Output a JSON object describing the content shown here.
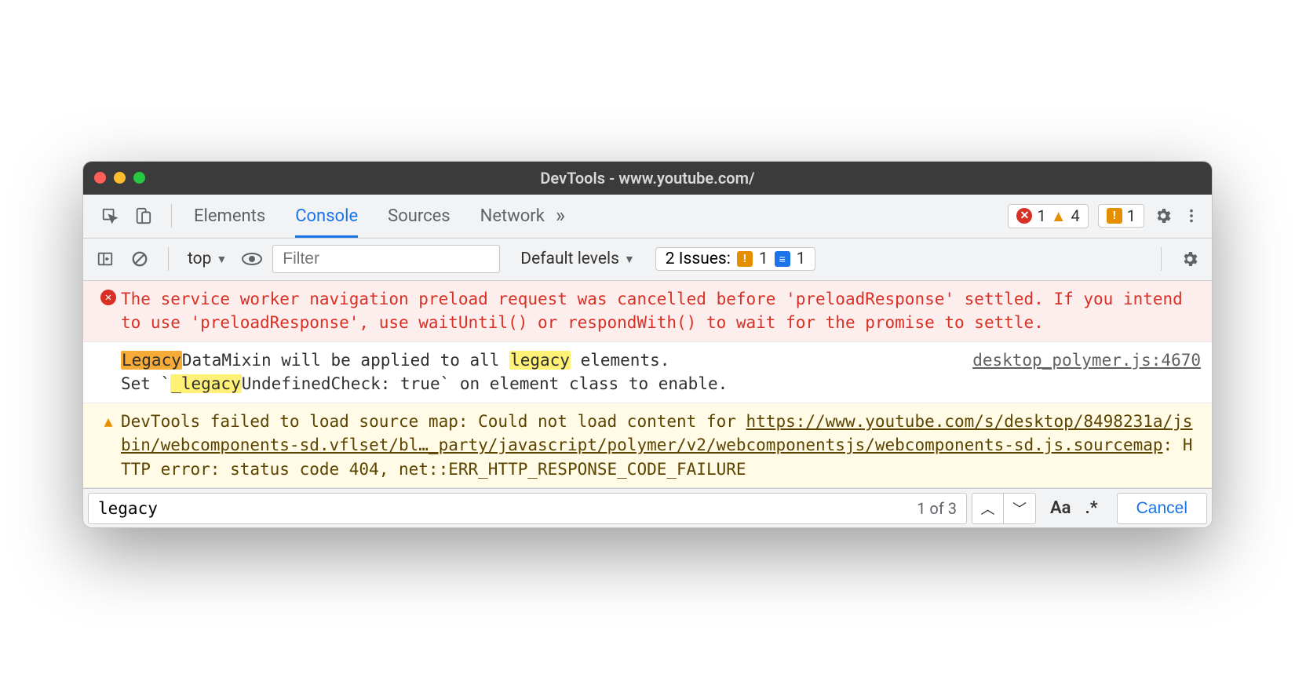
{
  "window": {
    "title": "DevTools - www.youtube.com/"
  },
  "tabs": {
    "items": [
      "Elements",
      "Console",
      "Sources",
      "Network"
    ],
    "active_index": 1
  },
  "badges": {
    "errors": "1",
    "warnings": "4",
    "issues_orange": "1"
  },
  "subtoolbar": {
    "context": "top",
    "filter_placeholder": "Filter",
    "levels": "Default levels",
    "issues_label": "2 Issues:",
    "issue_orange": "1",
    "issue_blue": "1"
  },
  "messages": {
    "error": {
      "text": "The service worker navigation preload request was cancelled before 'preloadResponse' settled. If you intend to use 'preloadResponse', use waitUntil() or respondWith() to wait for the promise to settle."
    },
    "info": {
      "pre1": "DataMixin will be applied to all ",
      "post1": " elements.",
      "hl_current": "Legacy",
      "hl2": "legacy",
      "line2a": "Set `",
      "hl3": "_legacy",
      "line2b": "UndefinedCheck: true` on element class to enable.",
      "src": "desktop_polymer.js:4670"
    },
    "warn": {
      "pre": "DevTools failed to load source map: Could not load content for ",
      "url": "https://www.youtube.com/s/desktop/8498231a/jsbin/webcomponents-sd.vflset/bl…_party/javascript/polymer/v2/webcomponentsjs/webcomponents-sd.js.sourcemap",
      "post": ": HTTP error: status code 404, net::ERR_HTTP_RESPONSE_CODE_FAILURE"
    }
  },
  "search": {
    "value": "legacy",
    "count": "1 of 3",
    "case_label": "Aa",
    "regex_label": ".*",
    "cancel": "Cancel"
  }
}
